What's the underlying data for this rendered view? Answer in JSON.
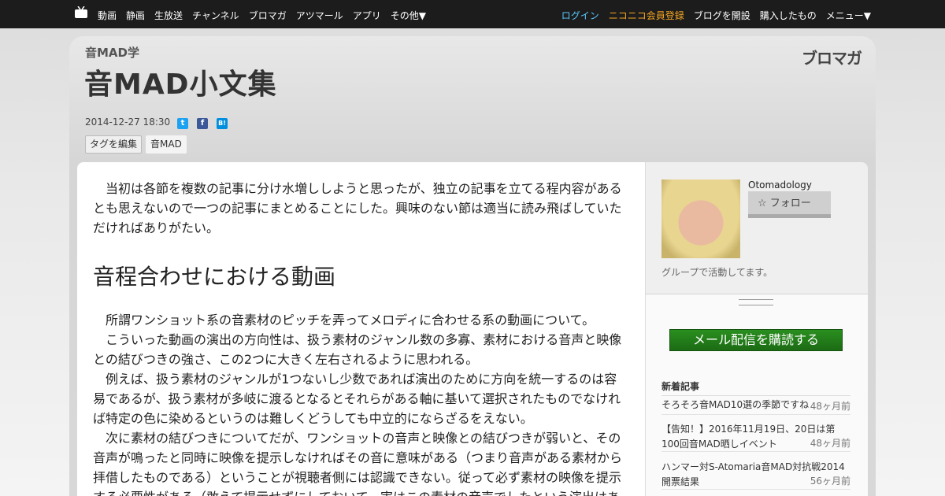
{
  "nav": {
    "left": [
      "動画",
      "静画",
      "生放送",
      "チャンネル",
      "ブロマガ",
      "アツマール",
      "アプリ",
      "その他▼"
    ],
    "right": [
      {
        "label": "ログイン",
        "color": "#5ac8ff"
      },
      {
        "label": "ニコニコ会員登録",
        "color": "#f5a623"
      },
      {
        "label": "ブログを開設",
        "color": "#ffffff"
      },
      {
        "label": "購入したもの",
        "color": "#ffffff"
      },
      {
        "label": "メニュー▼",
        "color": "#ffffff"
      }
    ]
  },
  "header": {
    "blog_name": "音MAD学",
    "title": "音MAD小文集",
    "brand": "ブロマガ",
    "date": "2014-12-27 18:30",
    "tag_edit": "タグを編集",
    "tags": [
      "音MAD"
    ]
  },
  "article": {
    "intro": "当初は各節を複数の記事に分け水増ししようと思ったが、独立の記事を立てる程内容があるとも思えないので一つの記事にまとめることにした。興味のない節は適当に読み飛ばしていただければありがたい。",
    "section_title": "音程合わせにおける動画",
    "paragraphs": [
      "所謂ワンショット系の音素材のピッチを弄ってメロディに合わせる系の動画について。",
      "こういった動画の演出の方向性は、扱う素材のジャンル数の多寡、素材における音声と映像との結びつきの強さ、この2つに大きく左右されるように思われる。",
      "例えば、扱う素材のジャンルが1つないし少数であれば演出のために方向を統一するのは容易であるが、扱う素材が多岐に渡るとなるとそれらがある軸に基いて選択されたものでなければ特定の色に染めるというのは難しくどうしても中立的にならざるをえない。",
      "次に素材の結びつきについてだが、ワンショットの音声と映像との結びつきが弱いと、その音声が鳴ったと同時に映像を提示しなければその音に意味がある（つまり音声がある素材から拝借したものである）ということが視聴者側には認識できない。従って必ず素材の映像を提示する必要性がある（敢えて提示せずにしておいて、実はこの素材の音声でしたという演出はあ"
    ]
  },
  "sidebar": {
    "author_name": "Otomadology",
    "follow_label": "フォロー",
    "author_desc": "グループで活動してます。",
    "subscribe_label": "メール配信を購読する",
    "recent_heading": "新着記事",
    "recent": [
      {
        "title": "そろそろ音MAD10選の季節ですね",
        "ago": "48ヶ月前"
      },
      {
        "title": "【告知！】2016年11月19日、20日は第100回音MAD晒しイベント",
        "ago": "48ヶ月前"
      },
      {
        "title": "ハンマー対S-Atomaria音MAD対抗戦2014開票結果",
        "ago": "56ヶ月前"
      }
    ]
  }
}
